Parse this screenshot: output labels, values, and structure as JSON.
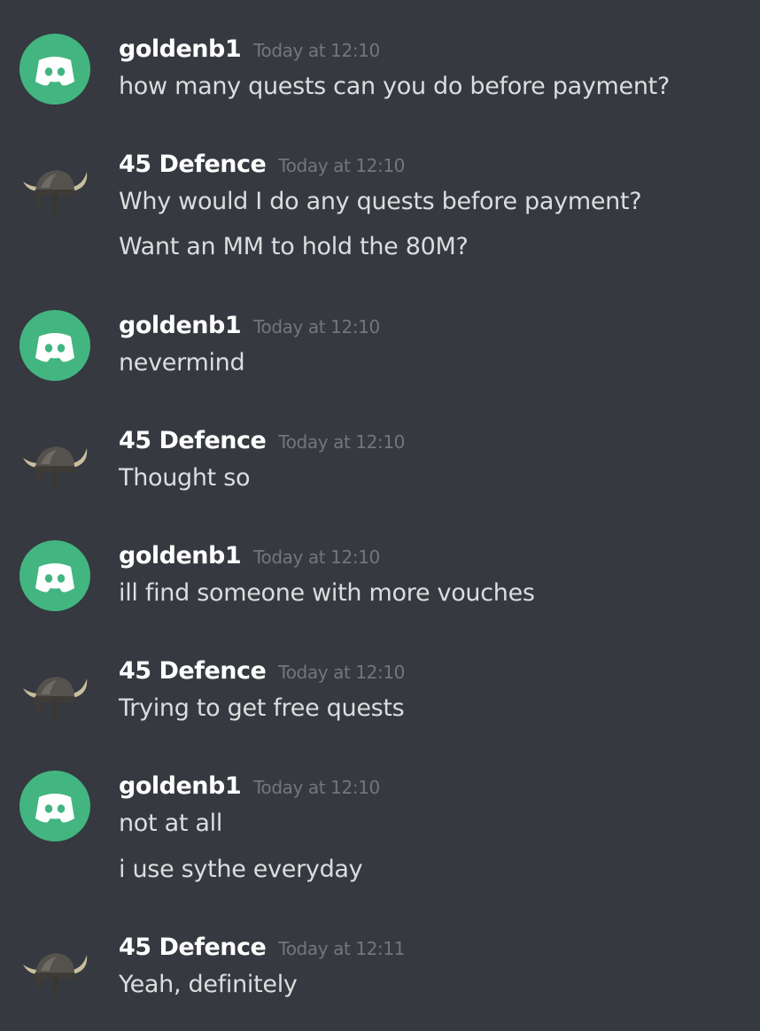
{
  "messages": [
    {
      "author": "goldenb1",
      "avatar": "discord-logo-icon",
      "time": "Today at 12:10",
      "lines": [
        "how many quests can you do before payment?"
      ]
    },
    {
      "author": "45 Defence",
      "avatar": "viking-helmet-icon",
      "time": "Today at 12:10",
      "lines": [
        "Why would I do any quests before payment?",
        "Want an MM to hold the 80M?"
      ]
    },
    {
      "author": "goldenb1",
      "avatar": "discord-logo-icon",
      "time": "Today at 12:10",
      "lines": [
        "nevermind"
      ]
    },
    {
      "author": "45 Defence",
      "avatar": "viking-helmet-icon",
      "time": "Today at 12:10",
      "lines": [
        "Thought so"
      ]
    },
    {
      "author": "goldenb1",
      "avatar": "discord-logo-icon",
      "time": "Today at 12:10",
      "lines": [
        "ill find someone with more vouches"
      ]
    },
    {
      "author": "45 Defence",
      "avatar": "viking-helmet-icon",
      "time": "Today at 12:10",
      "lines": [
        "Trying to get free quests"
      ]
    },
    {
      "author": "goldenb1",
      "avatar": "discord-logo-icon",
      "time": "Today at 12:10",
      "lines": [
        "not at all",
        "i use sythe everyday"
      ]
    },
    {
      "author": "45 Defence",
      "avatar": "viking-helmet-icon",
      "time": "Today at 12:11",
      "lines": [
        "Yeah, definitely"
      ]
    }
  ],
  "colors": {
    "background": "#36393f",
    "username": "#ffffff",
    "timestamp": "#72767d",
    "message_text": "#dcddde",
    "discord_avatar": "#43b581"
  }
}
